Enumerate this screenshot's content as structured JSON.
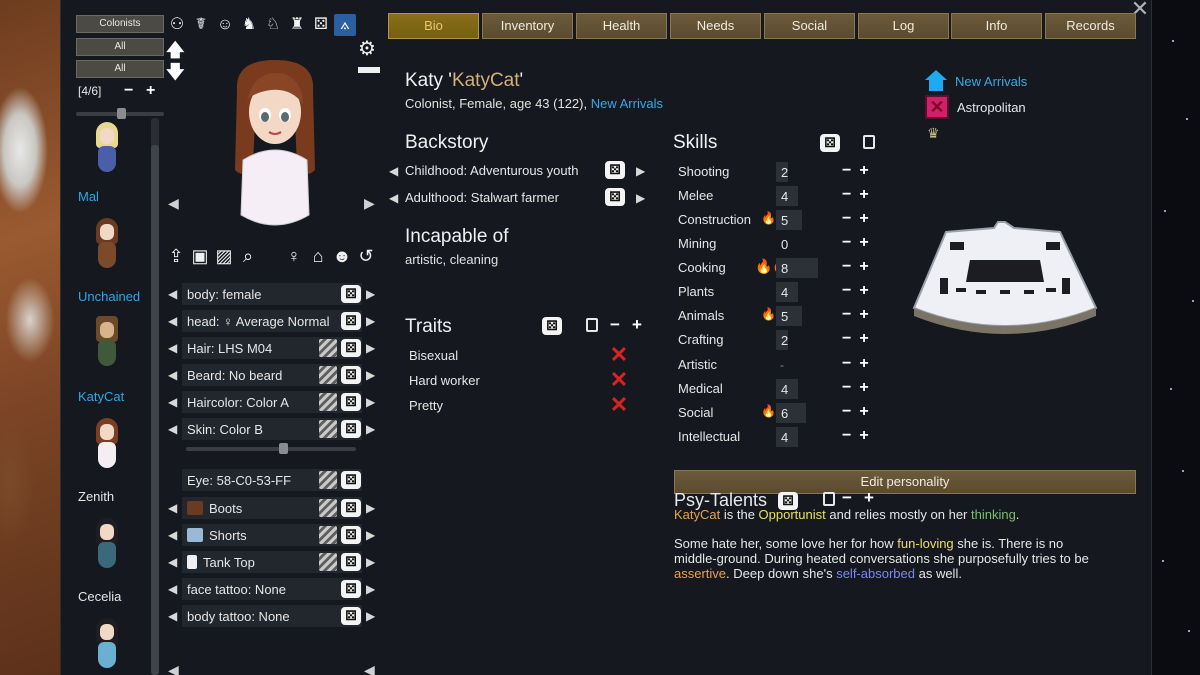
{
  "filters": {
    "group_label": "Colonists",
    "filter1": "All",
    "filter2": "All"
  },
  "counter": {
    "text": "[4/6]",
    "minus": "−",
    "plus": "+"
  },
  "colonists": [
    {
      "name": "Mal",
      "name_color": "#2aa8e8"
    },
    {
      "name": "Unchained",
      "name_color": "#2aa8e8"
    },
    {
      "name": "KatyCat",
      "name_color": "#2aa8e8"
    },
    {
      "name": "Zenith",
      "name_color": "#e6e6e6"
    },
    {
      "name": "Cecelia",
      "name_color": "#e6e6e6"
    }
  ],
  "icon_strip": [
    "pawns-icon",
    "medical-icon",
    "head-icon",
    "animal-icon",
    "horse-icon",
    "robot-icon",
    "dice-icon",
    "ship-icon"
  ],
  "tabs": [
    {
      "label": "Bio",
      "active": true
    },
    {
      "label": "Inventory",
      "active": false
    },
    {
      "label": "Health",
      "active": false
    },
    {
      "label": "Needs",
      "active": false
    },
    {
      "label": "Social",
      "active": false
    },
    {
      "label": "Log",
      "active": false
    },
    {
      "label": "Info",
      "active": false
    },
    {
      "label": "Records",
      "active": false
    }
  ],
  "appearance": {
    "rows": [
      {
        "label": "body: female",
        "stripes": false
      },
      {
        "label": "head: ♀ Average Normal",
        "stripes": false
      },
      {
        "label": "Hair: LHS M04",
        "stripes": true
      },
      {
        "label": "Beard: No beard",
        "stripes": true
      },
      {
        "label": "Haircolor: Color A",
        "stripes": true
      },
      {
        "label": "Skin: Color B",
        "stripes": true
      }
    ],
    "eye": "Eye: 58-C0-53-FF",
    "apparel": [
      {
        "label": "Boots",
        "icon": "boots-icon",
        "color": "#6a3a22"
      },
      {
        "label": "Shorts",
        "icon": "shorts-icon",
        "color": "#9ab9d6"
      },
      {
        "label": "Tank Top",
        "icon": "tanktop-icon",
        "color": "#f0f0f0"
      }
    ],
    "tattoos": [
      "face tattoo: None",
      "body tattoo: None"
    ]
  },
  "bio": {
    "first_name": "Katy",
    "nick": "KatyCat",
    "desc": "Colonist, Female, age 43 (122), ",
    "faction_link": "New Arrivals"
  },
  "backstory": {
    "title": "Backstory",
    "childhood": "Childhood: Adventurous youth",
    "adulthood": "Adulthood: Stalwart farmer"
  },
  "incapable": {
    "title": "Incapable of",
    "text": "artistic, cleaning"
  },
  "traits": {
    "title": "Traits",
    "items": [
      "Bisexual",
      "Hard worker",
      "Pretty"
    ]
  },
  "skills": {
    "title": "Skills",
    "items": [
      {
        "name": "Shooting",
        "level": "2",
        "passion": 0
      },
      {
        "name": "Melee",
        "level": "4",
        "passion": 0
      },
      {
        "name": "Construction",
        "level": "5",
        "passion": 1
      },
      {
        "name": "Mining",
        "level": "0",
        "passion": 0
      },
      {
        "name": "Cooking",
        "level": "8",
        "passion": 2
      },
      {
        "name": "Plants",
        "level": "4",
        "passion": 0
      },
      {
        "name": "Animals",
        "level": "5",
        "passion": 1
      },
      {
        "name": "Crafting",
        "level": "2",
        "passion": 0
      },
      {
        "name": "Artistic",
        "level": "-",
        "passion": 0
      },
      {
        "name": "Medical",
        "level": "4",
        "passion": 0
      },
      {
        "name": "Social",
        "level": "6",
        "passion": 1
      },
      {
        "name": "Intellectual",
        "level": "4",
        "passion": 0
      }
    ]
  },
  "faction": {
    "primary": "New Arrivals",
    "ideology": "Astropolitan"
  },
  "personality": {
    "edit_button": "Edit personality",
    "psy_title": "Psy-Talents",
    "p1": {
      "name": "KatyCat",
      "t1": " is the ",
      "role": "Opportunist",
      "t2": " and relies mostly on her ",
      "mode": "thinking",
      "t3": "."
    },
    "p2": {
      "t1": "Some hate her, some love her for how ",
      "a1": "fun-loving",
      "t2": " she is. There is no middle-ground. During heated conversations she purposefully tries to be ",
      "a2": "assertive",
      "t3": ". Deep down she's ",
      "a3": "self-absorbed",
      "t4": " as well."
    }
  }
}
